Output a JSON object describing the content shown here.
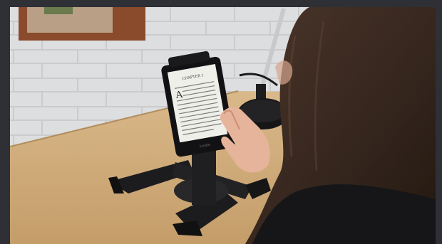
{
  "image": {
    "alt": "",
    "colors": {
      "frame": "#2f3036",
      "wall": "#d9dbdc",
      "desk": "#caa775",
      "stand": "#1c1c1e",
      "hair": "#3b2a22",
      "skin": "#e9b9a0",
      "screen": "#efefea"
    }
  },
  "ereader": {
    "chapter_heading": "CHAPTER 1",
    "brand": "kindle"
  }
}
